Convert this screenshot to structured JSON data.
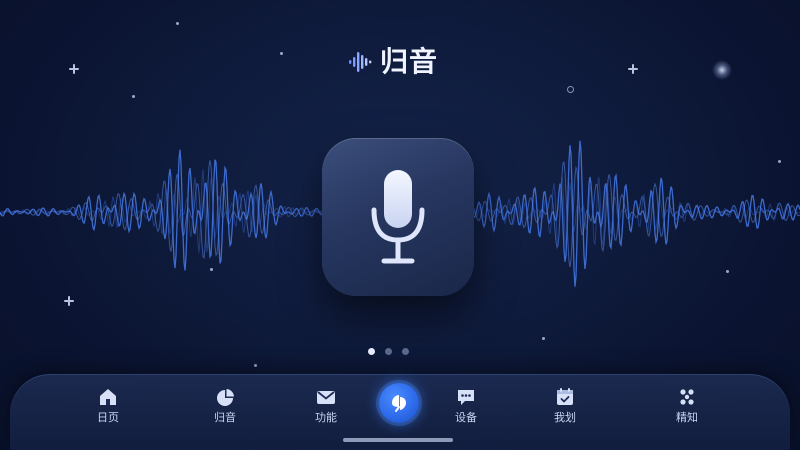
{
  "app": {
    "logo_text": "归音",
    "logo_icon": "waveform-icon"
  },
  "main": {
    "mic_icon": "microphone-icon",
    "pager": {
      "count": 3,
      "active_index": 0
    }
  },
  "nav": {
    "items": [
      {
        "label": "日页",
        "icon": "home-icon"
      },
      {
        "label": "归音",
        "icon": "pie-chart-icon"
      },
      {
        "label": "功能",
        "icon": "mail-icon"
      },
      {
        "label": "",
        "icon": "leaf-fab-icon"
      },
      {
        "label": "设备",
        "icon": "chat-bubble-icon"
      },
      {
        "label": "我划",
        "icon": "calendar-icon"
      },
      {
        "label": "精知",
        "icon": "dots-grid-icon"
      }
    ]
  },
  "colors": {
    "background": "#0e1a3a",
    "wave": "#3f6fd6",
    "accent": "#2c68e8",
    "text": "#c9d4f0"
  }
}
